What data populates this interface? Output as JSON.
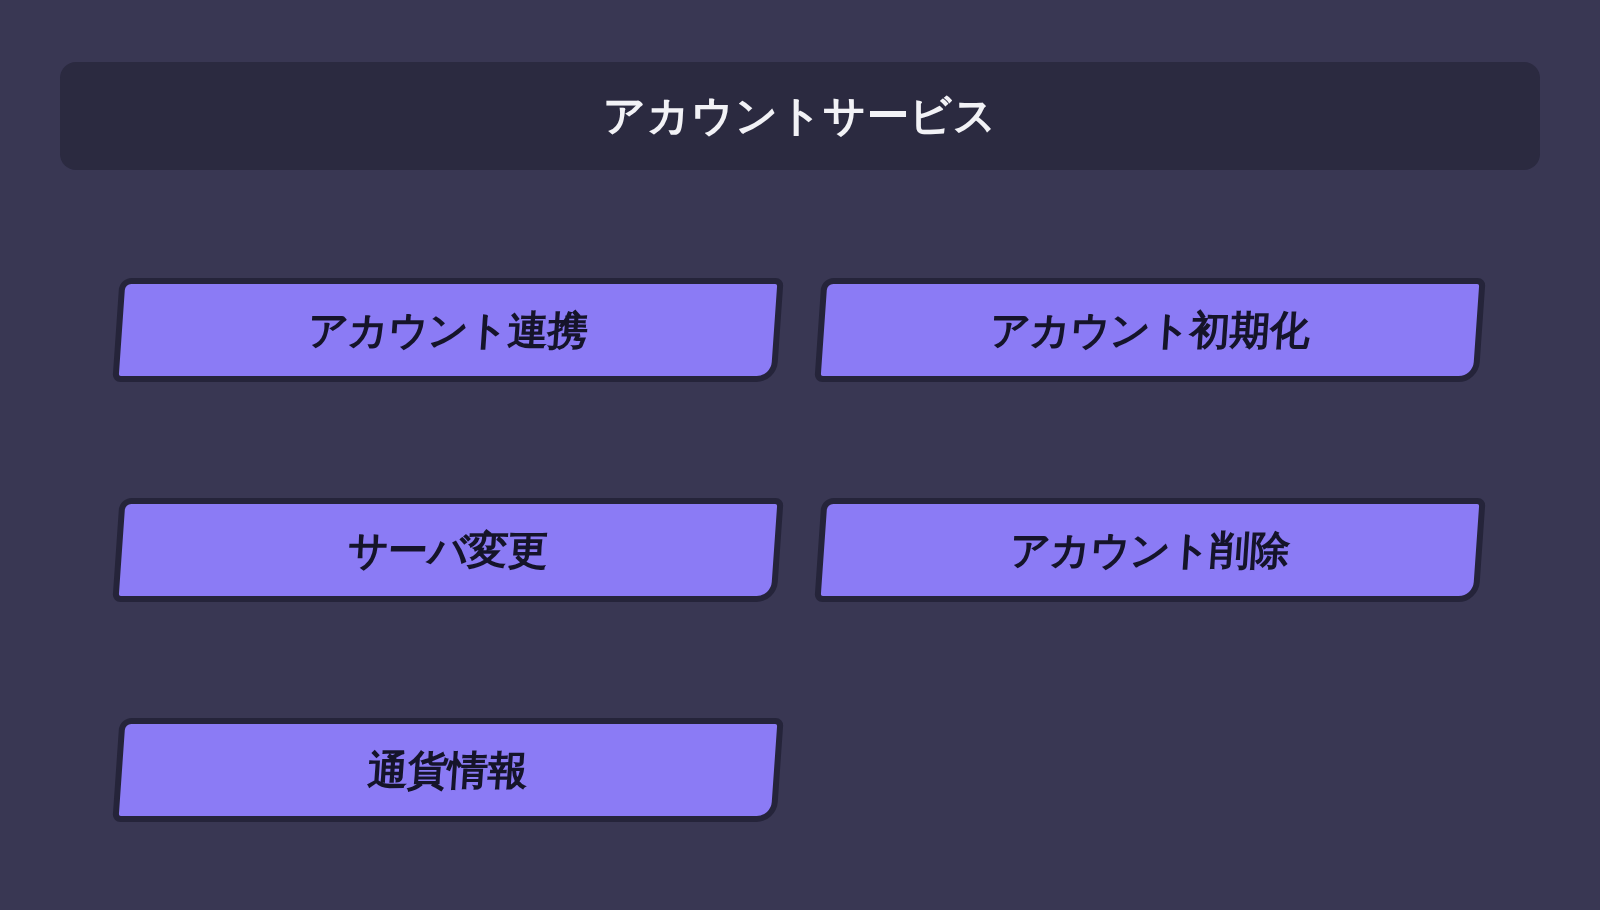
{
  "header": {
    "title": "アカウントサービス"
  },
  "buttons": [
    {
      "label": "アカウント連携"
    },
    {
      "label": "アカウント初期化"
    },
    {
      "label": "サーバ変更"
    },
    {
      "label": "アカウント削除"
    },
    {
      "label": "通貨情報"
    }
  ]
}
